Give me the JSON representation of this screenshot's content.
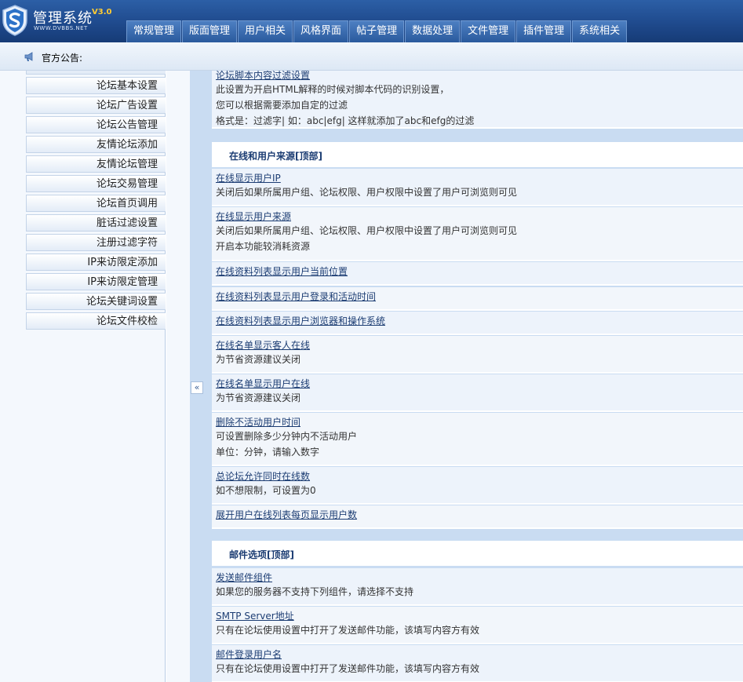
{
  "app": {
    "title": "管理系统",
    "version": "V3.0",
    "url": "WWW.DVBBS.NET"
  },
  "nav": {
    "tabs": [
      "常规管理",
      "版面管理",
      "用户相关",
      "风格界面",
      "帖子管理",
      "数据处理",
      "文件管理",
      "插件管理",
      "系统相关"
    ]
  },
  "notice": {
    "label": "官方公告:"
  },
  "sidebar": {
    "items": [
      "论坛基本设置",
      "论坛广告设置",
      "论坛公告管理",
      "友情论坛添加",
      "友情论坛管理",
      "论坛交易管理",
      "论坛首页调用",
      "脏话过滤设置",
      "注册过滤字符",
      "IP来访限定添加",
      "IP来访限定管理",
      "论坛关键词设置",
      "论坛文件校检"
    ]
  },
  "splitter": {
    "collapse_label": "«"
  },
  "main": {
    "top_row": {
      "title": "论坛脚本内容过滤设置",
      "desc1": "此设置为开启HTML解释的时候对脚本代码的识别设置，",
      "desc2": "您可以根据需要添加自定的过滤",
      "desc3": "格式是：过滤字| 如：abc|efg| 这样就添加了abc和efg的过滤"
    },
    "section1": {
      "heading": "在线和用户来源[顶部]",
      "rows": [
        {
          "title": "在线显示用户IP",
          "desc": [
            "关闭后如果所属用户组、论坛权限、用户权限中设置了用户可浏览则可见"
          ]
        },
        {
          "title": "在线显示用户来源",
          "desc": [
            "关闭后如果所属用户组、论坛权限、用户权限中设置了用户可浏览则可见",
            "开启本功能较消耗资源"
          ]
        },
        {
          "title": "在线资料列表显示用户当前位置",
          "desc": []
        },
        {
          "title": "在线资料列表显示用户登录和活动时间",
          "desc": []
        },
        {
          "title": "在线资料列表显示用户浏览器和操作系统",
          "desc": []
        },
        {
          "title": "在线名单显示客人在线",
          "desc": [
            "为节省资源建议关闭"
          ]
        },
        {
          "title": "在线名单显示用户在线",
          "desc": [
            "为节省资源建议关闭"
          ]
        },
        {
          "title": "删除不活动用户时间",
          "desc": [
            "可设置删除多少分钟内不活动用户",
            "单位：分钟，请输入数字"
          ]
        },
        {
          "title": "总论坛允许同时在线数",
          "desc": [
            "如不想限制，可设置为0"
          ]
        },
        {
          "title": "展开用户在线列表每页显示用户数",
          "desc": []
        }
      ]
    },
    "section2": {
      "heading": "邮件选项[顶部]",
      "rows": [
        {
          "title": "发送邮件组件",
          "desc": [
            "如果您的服务器不支持下列组件，请选择不支持"
          ]
        },
        {
          "title": "SMTP Server地址",
          "desc": [
            "只有在论坛使用设置中打开了发送邮件功能，该填写内容方有效"
          ]
        },
        {
          "title": "邮件登录用户名",
          "desc": [
            "只有在论坛使用设置中打开了发送邮件功能，该填写内容方有效"
          ]
        }
      ]
    }
  }
}
